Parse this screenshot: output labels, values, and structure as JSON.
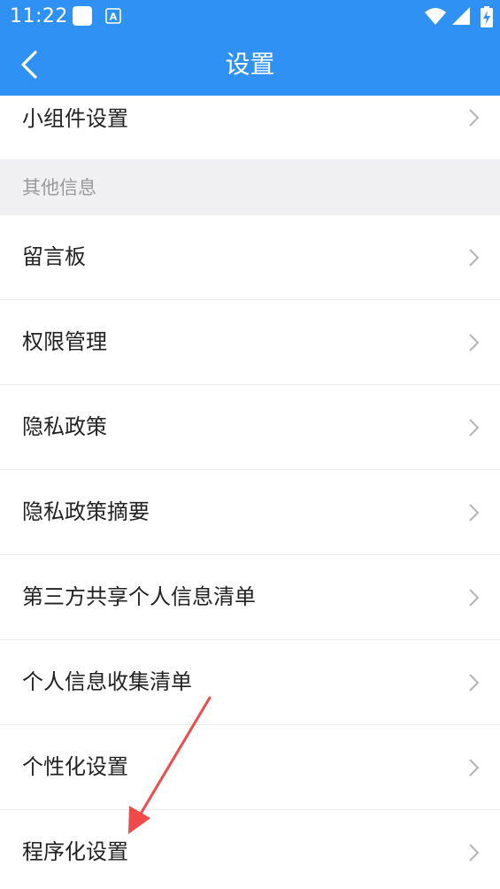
{
  "status_bar": {
    "time": "11:22",
    "notification_icons": [
      "app-notification-icon",
      "a-badge-icon"
    ],
    "system_icons": [
      "wifi-icon",
      "cellular-signal-icon",
      "battery-charging-icon"
    ]
  },
  "header": {
    "title": "设置",
    "back_icon": "chevron-left-icon"
  },
  "list": {
    "top_item": {
      "label": "小组件设置"
    },
    "section_title": "其他信息",
    "items": [
      {
        "label": "留言板"
      },
      {
        "label": "权限管理"
      },
      {
        "label": "隐私政策"
      },
      {
        "label": "隐私政策摘要"
      },
      {
        "label": "第三方共享个人信息清单"
      },
      {
        "label": "个人信息收集清单"
      },
      {
        "label": "个性化设置"
      },
      {
        "label": "程序化设置"
      }
    ]
  },
  "annotation": {
    "type": "red-arrow",
    "points_to": "程序化设置"
  },
  "colors": {
    "primary": "#2f91f4",
    "section_bg": "#f0f0f2",
    "annotation": "#f04a4a"
  }
}
